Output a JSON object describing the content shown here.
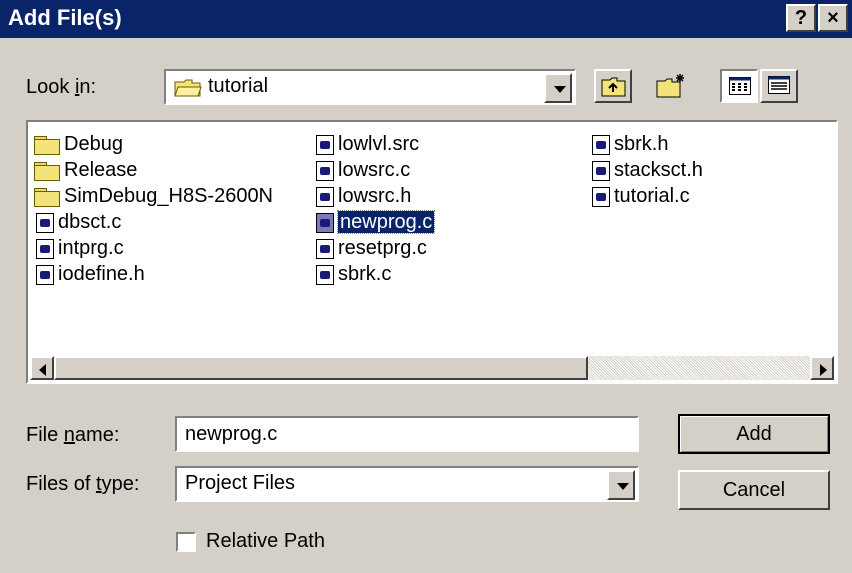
{
  "window": {
    "title": "Add File(s)",
    "help_glyph": "?",
    "close_glyph": "×"
  },
  "lookin": {
    "label_pre": "Look ",
    "label_accel": "i",
    "label_post": "n:",
    "value": "tutorial",
    "icon": "folder-open-icon"
  },
  "toolbar": {
    "up_icon": "up-one-level-icon",
    "new_folder_icon": "new-folder-icon",
    "list_icon": "list-view-icon",
    "details_icon": "details-view-icon"
  },
  "files": {
    "col1": [
      {
        "name": "Debug",
        "type": "folder"
      },
      {
        "name": "Release",
        "type": "folder"
      },
      {
        "name": "SimDebug_H8S-2600N",
        "type": "folder"
      },
      {
        "name": "dbsct.c",
        "type": "file"
      },
      {
        "name": "intprg.c",
        "type": "file"
      },
      {
        "name": "iodefine.h",
        "type": "file"
      }
    ],
    "col2": [
      {
        "name": "lowlvl.src",
        "type": "file"
      },
      {
        "name": "lowsrc.c",
        "type": "file"
      },
      {
        "name": "lowsrc.h",
        "type": "file"
      },
      {
        "name": "newprog.c",
        "type": "file",
        "selected": true
      },
      {
        "name": "resetprg.c",
        "type": "file"
      },
      {
        "name": "sbrk.c",
        "type": "file"
      }
    ],
    "col3": [
      {
        "name": "sbrk.h",
        "type": "file"
      },
      {
        "name": "stacksct.h",
        "type": "file"
      },
      {
        "name": "tutorial.c",
        "type": "file"
      }
    ]
  },
  "filename": {
    "label_pre": "File ",
    "label_accel": "n",
    "label_post": "ame:",
    "value": "newprog.c"
  },
  "filetype": {
    "label_pre": "Files of ",
    "label_accel": "t",
    "label_post": "ype:",
    "value": "Project Files"
  },
  "buttons": {
    "add": "Add",
    "cancel": "Cancel"
  },
  "relative_path": {
    "label": "Relative Path",
    "checked": false
  }
}
